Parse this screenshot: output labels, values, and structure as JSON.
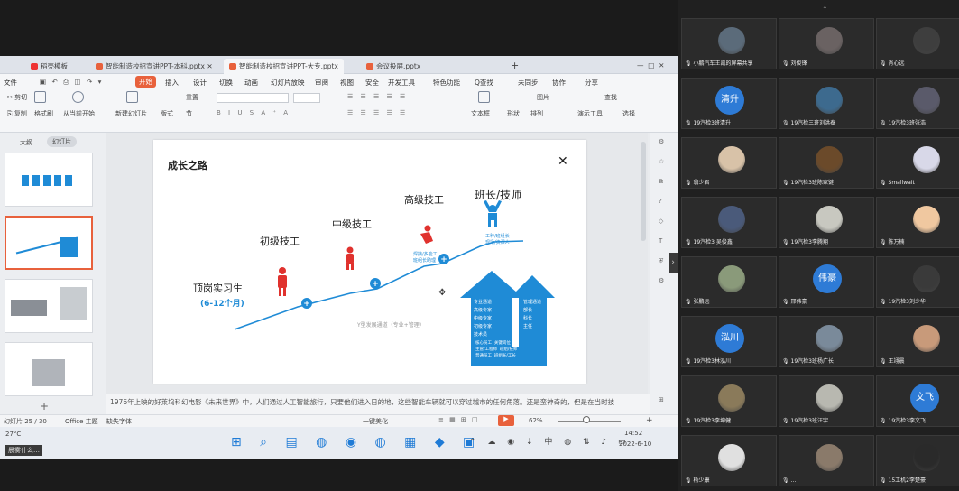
{
  "wps": {
    "tabs": [
      {
        "label": "稻壳模板"
      },
      {
        "label": "智能制造校招宣讲PPT-本科.pptx"
      },
      {
        "label": "智能制造校招宣讲PPT-大专.pptx"
      },
      {
        "label": "会议投屏.pptx"
      }
    ],
    "menu": [
      "文件",
      "开始",
      "插入",
      "设计",
      "切换",
      "动画",
      "幻灯片放映",
      "审阅",
      "视图",
      "安全",
      "开发工具",
      "特色功能",
      "Q查找"
    ],
    "menu_right": [
      "未同步",
      "协作",
      "分享"
    ],
    "ribbon": {
      "paste": "粘贴",
      "cut": "剪切",
      "copy": "复制",
      "format_painter": "格式刷",
      "from_start": "从当前开始",
      "new_slide": "新建幻灯片",
      "layout": "版式",
      "section": "节",
      "reset": "重置",
      "textbox": "文本框",
      "shape": "形状",
      "arrange": "排列",
      "image": "图片",
      "find": "查找",
      "present_tools": "演示工具",
      "select": "选择"
    },
    "panel_tabs": [
      "大纲",
      "幻灯片"
    ],
    "slide": {
      "title": "成长之路",
      "steps": [
        {
          "label": "顶岗实习生",
          "sub": "(6-12个月)"
        },
        {
          "label": "初级技工",
          "sub": ""
        },
        {
          "label": "中级技工",
          "sub": ""
        },
        {
          "label": "高级技工",
          "sub": ""
        },
        {
          "label": "班长/技师",
          "sub": ""
        }
      ],
      "caption": "Y型发展通道（专业+管理）",
      "callout1": "工种/班组长\n现场/资深人",
      "callout2": "焊接/多能工\n班组长助理",
      "arrow_left_items": [
        "专业通道",
        "高级专家",
        "中级专家",
        "初级专家",
        "技术员"
      ],
      "arrow_right_items": [
        "管理通道",
        "部长",
        "科长",
        "主任"
      ],
      "base_items": [
        "核心员工",
        "关键岗位",
        "主管/工程师",
        "班组/技师",
        "普通员工",
        "班组长/工长"
      ]
    },
    "notes": "1976年上映的好莱坞科幻电影《未来世界》中，人们通过人工智能旅行，只要他们进入日的地，这些智能车辆就可以穿过城市的任何角落。还是蛮神奇的，但是在当时技",
    "status": {
      "slide_pos": "幻灯片 25 / 30",
      "theme": "Office 主题",
      "missing_font": "缺失字体",
      "beautify": "一键美化",
      "zoom": "62%"
    },
    "taskbar": {
      "weather_temp": "27°C",
      "weather_text": "晨雾什么…",
      "time": "14:52",
      "date": "2022-6-10"
    }
  },
  "participants": [
    {
      "name": "小鹏汽车王凯的屏幕共享",
      "kind": "photo",
      "color": "#5b6b7a"
    },
    {
      "name": "刘俊锋",
      "kind": "photo",
      "color": "#6a6262"
    },
    {
      "name": "肖心远",
      "kind": "photo",
      "color": "#3e3e3e"
    },
    {
      "name": "19汽检3班清升",
      "kind": "text",
      "text": "清升",
      "color": "#2e7bd6"
    },
    {
      "name": "19汽检三班刘洪泰",
      "kind": "photo",
      "color": "#3d6a8e"
    },
    {
      "name": "19汽检3班张浩",
      "kind": "photo",
      "color": "#5a5a6a"
    },
    {
      "name": "翁少君",
      "kind": "photo",
      "color": "#d8c2a8"
    },
    {
      "name": "19汽检3班陈家键",
      "kind": "photo",
      "color": "#6b4a2a"
    },
    {
      "name": "Smallwait",
      "kind": "photo",
      "color": "#d8d8e8"
    },
    {
      "name": "19汽检3 吴俊鑫",
      "kind": "photo",
      "color": "#4a5a7a"
    },
    {
      "name": "19汽检3李腾翔",
      "kind": "photo",
      "color": "#c8c8c0"
    },
    {
      "name": "陈万楠",
      "kind": "photo",
      "color": "#f0c8a0"
    },
    {
      "name": "张鹏远",
      "kind": "photo",
      "color": "#8a9a7a"
    },
    {
      "name": "邢伟豪",
      "kind": "text",
      "text": "伟豪",
      "color": "#2e7bd6"
    },
    {
      "name": "19汽检3刘少华",
      "kind": "photo",
      "color": "#3a3a3a"
    },
    {
      "name": "19汽检3林泓川",
      "kind": "text",
      "text": "泓川",
      "color": "#2e7bd6"
    },
    {
      "name": "19汽检3班杨广长",
      "kind": "photo",
      "color": "#7a8a9a"
    },
    {
      "name": "王翊晨",
      "kind": "photo",
      "color": "#c89a7a"
    },
    {
      "name": "19汽检3李坤健",
      "kind": "photo",
      "color": "#8a7a5a"
    },
    {
      "name": "19汽检3班汪宇",
      "kind": "photo",
      "color": "#b8b8b0"
    },
    {
      "name": "19汽检3李文飞",
      "kind": "text",
      "text": "文飞",
      "color": "#2e7bd6"
    },
    {
      "name": "杨少康",
      "kind": "photo",
      "color": "#e0e0e0"
    },
    {
      "name": "...",
      "kind": "photo",
      "color": "#8a7a6a"
    },
    {
      "name": "15工机2李楚豪",
      "kind": "photo",
      "color": "#2a2a2a"
    }
  ]
}
